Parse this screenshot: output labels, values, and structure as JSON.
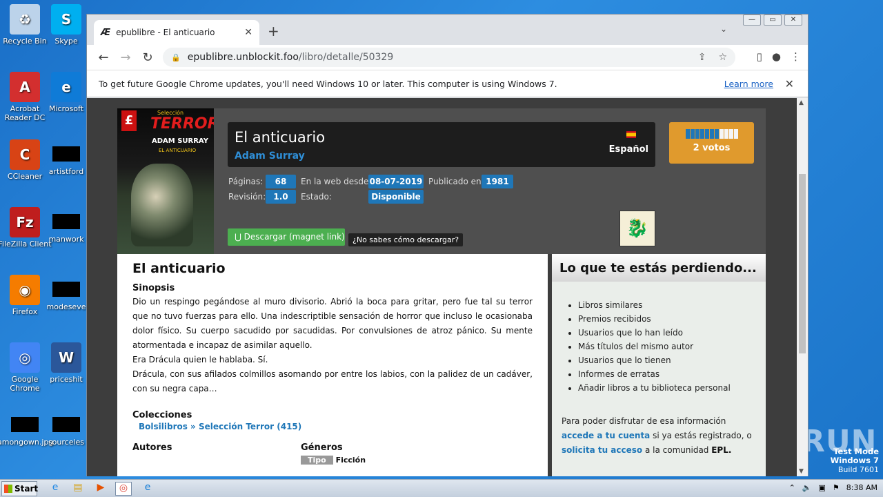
{
  "desktop": {
    "icons": [
      {
        "label": "Recycle Bin",
        "color": "#bcd3ea",
        "glyph": "♻"
      },
      {
        "label": "Skype",
        "color": "#00aff0",
        "glyph": "S"
      },
      {
        "label": "Acrobat Reader DC",
        "color": "#d32f2f",
        "glyph": "A"
      },
      {
        "label": "Microsoft",
        "color": "#0f7bd7",
        "glyph": "e"
      },
      {
        "label": "CCleaner",
        "color": "#d84315",
        "glyph": "C"
      },
      {
        "label": "artistford",
        "color": "#000000",
        "glyph": ""
      },
      {
        "label": "FileZilla Client",
        "color": "#bf1e1e",
        "glyph": "Fz"
      },
      {
        "label": "manwork",
        "color": "#000000",
        "glyph": ""
      },
      {
        "label": "Firefox",
        "color": "#f57c00",
        "glyph": "◉"
      },
      {
        "label": "modeseve",
        "color": "#000000",
        "glyph": ""
      },
      {
        "label": "Google Chrome",
        "color": "#4285f4",
        "glyph": "◎"
      },
      {
        "label": "priceshit",
        "color": "#2b579a",
        "glyph": "W"
      },
      {
        "label": "amongown.jpg",
        "color": "#000000",
        "glyph": ""
      },
      {
        "label": "sourceles",
        "color": "#000000",
        "glyph": ""
      }
    ]
  },
  "browser": {
    "tab_title": "epublibre - El anticuario",
    "tab_favicon": "Æ",
    "url_host": "epublibre.unblockit.foo",
    "url_path": "/libro/detalle/50329",
    "window_controls": [
      "—",
      "▭",
      "✕"
    ],
    "infobar_text": "To get future Google Chrome updates, you'll need Windows 10 or later. This computer is using Windows 7.",
    "infobar_link": "Learn more"
  },
  "book": {
    "cover": {
      "series": "Selección",
      "brand": "TERROR",
      "author": "ADAM SURRAY",
      "title": "EL ANTICUARIO"
    },
    "title": "El anticuario",
    "author": "Adam Surray",
    "language": "Español",
    "votes_label": "2 votos",
    "rating_fraction": 0.63,
    "labels": {
      "pages": "Páginas:",
      "since": "En la web desde:",
      "published": "Publicado en:",
      "revision": "Revisión:",
      "status": "Estado:"
    },
    "pages": "68",
    "web_since": "08-07-2019",
    "published": "1981",
    "revision": "1.0",
    "status": "Disponible",
    "download_label": "Descargar (magnet link)",
    "help_label": "¿No sabes cómo descargar?"
  },
  "main": {
    "heading": "El anticuario",
    "synopsis_label": "Sinopsis",
    "synopsis": [
      "Dio un respingo pegándose al muro divisorio. Abrió la boca para gritar, pero fue tal su terror que no tuvo fuerzas para ello. Una indescriptible sensación de horror que incluso le ocasionaba dolor físico. Su cuerpo sacudido por sacudidas. Por convulsiones de atroz pánico. Su mente atormentada e incapaz de asimilar aquello.",
      "Era Drácula quien le hablaba. Sí.",
      "Drácula, con sus afilados colmillos asomando por entre los labios, con la palidez de un cadáver, con su negra capa…"
    ],
    "collections_label": "Colecciones",
    "collection": "Bolsilibros » Selección Terror (415)",
    "authors_label": "Autores",
    "genres_label": "Géneros",
    "genre_tag": "Tipo",
    "genre_value": "Ficción"
  },
  "side": {
    "heading": "Lo que te estás perdiendo...",
    "items": [
      "Libros similares",
      "Premios recibidos",
      "Usuarios que lo han leído",
      "Más títulos del mismo autor",
      "Usuarios que lo tienen",
      "Informes de erratas",
      "Añadir libros a tu biblioteca personal"
    ],
    "p1": "Para poder disfrutar de esa información",
    "link1": "accede a tu cuenta",
    "p2": " si ya estás registrado, o",
    "link2": "solicita tu acceso",
    "p3": " a la comunidad ",
    "epl": "EPL."
  },
  "taskbar": {
    "start_label": "Start",
    "clock": "8:38 AM"
  },
  "watermark": {
    "line1": "Test Mode",
    "line2": "Windows 7",
    "line3": "Build 7601",
    "brand": "ANY RUN"
  }
}
